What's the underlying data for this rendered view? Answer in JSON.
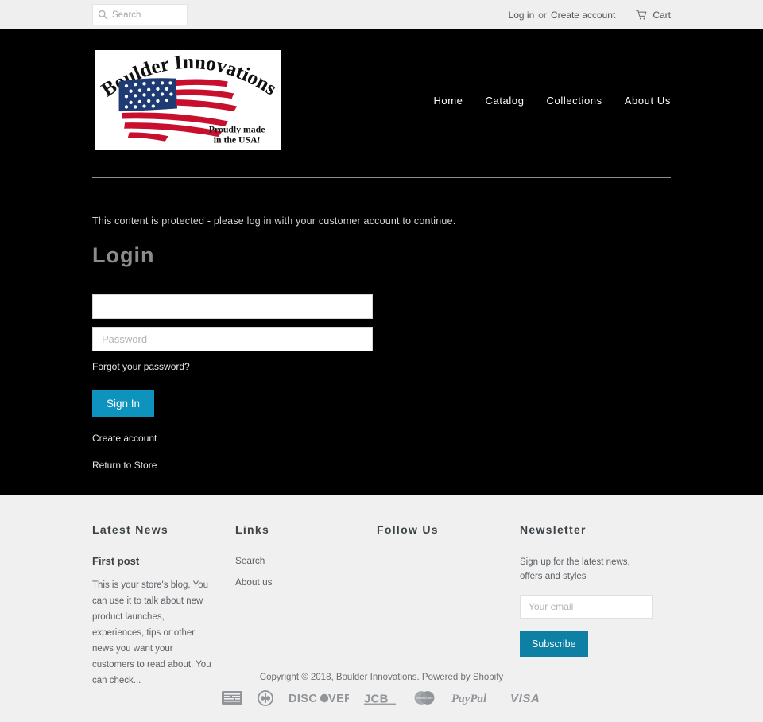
{
  "topbar": {
    "search_placeholder": "Search",
    "search_value": "",
    "search_icon": "search-icon",
    "login_label": "Log in",
    "or_label": "or",
    "create_account_label": "Create account",
    "cart_label": "Cart",
    "cart_icon": "shopping-cart-icon"
  },
  "header": {
    "logo": {
      "brand_line": "Boulder Innovations",
      "tagline_line1": "Proudly made",
      "tagline_line2": "in the USA!",
      "flag_red": "#c8102e",
      "flag_blue": "#1f3b73"
    },
    "nav": [
      {
        "label": "Home"
      },
      {
        "label": "Catalog"
      },
      {
        "label": "Collections"
      },
      {
        "label": "About Us"
      }
    ]
  },
  "main": {
    "protected_message": "This content is protected - please log in with your customer account to continue.",
    "title": "Login",
    "email_placeholder": "",
    "email_value": "",
    "password_placeholder": "Password",
    "password_value": "",
    "forgot_password_label": "Forgot your password?",
    "sign_in_label": "Sign In",
    "create_account_label": "Create account",
    "return_to_store_label": "Return to Store",
    "accent_color": "#0d93bd"
  },
  "footer": {
    "columns": {
      "latest_news": {
        "heading": "Latest News",
        "post_title": "First post",
        "post_excerpt": "This is your store's blog. You can use it to talk about new product launches, experiences, tips or other news you want your customers to read about. You can check..."
      },
      "links": {
        "heading": "Links",
        "items": [
          {
            "label": "Search"
          },
          {
            "label": "About us"
          }
        ]
      },
      "follow_us": {
        "heading": "Follow Us"
      },
      "newsletter": {
        "heading": "Newsletter",
        "description": "Sign up for the latest news, offers and styles",
        "email_placeholder": "Your email",
        "email_value": "",
        "subscribe_label": "Subscribe",
        "button_color": "#0d80a3"
      }
    },
    "copyright": "Copyright © 2018, Boulder Innovations. Powered by Shopify",
    "payment_methods": [
      {
        "name": "american-express"
      },
      {
        "name": "diners-club"
      },
      {
        "name": "discover"
      },
      {
        "name": "jcb"
      },
      {
        "name": "mastercard"
      },
      {
        "name": "paypal"
      },
      {
        "name": "visa"
      }
    ]
  }
}
